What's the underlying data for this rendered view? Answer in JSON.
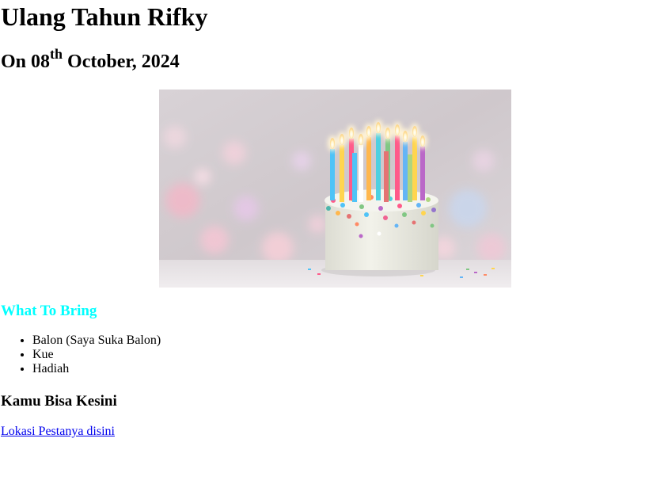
{
  "header": {
    "title": "Ulang Tahun Rifky",
    "date_prefix": "On 08",
    "date_suffix_sup": "th",
    "date_rest": " October, 2024"
  },
  "hero_image": {
    "subject": "birthday-cake-with-candles"
  },
  "bring": {
    "heading": "What To Bring",
    "heading_color": "#00ffff",
    "items": [
      "Balon (Saya Suka Balon)",
      "Kue",
      "Hadiah"
    ]
  },
  "location": {
    "heading": "Kamu Bisa Kesini",
    "link_text": "Lokasi Pestanya disini",
    "link_color": "#0000ee"
  }
}
